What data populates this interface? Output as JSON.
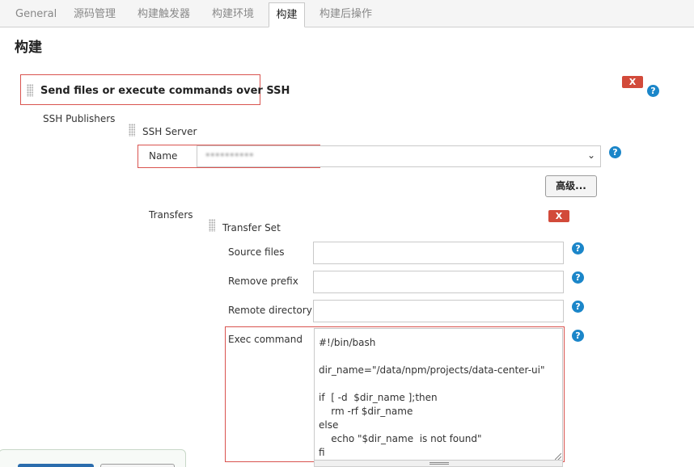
{
  "tabs": [
    {
      "label": "General"
    },
    {
      "label": "源码管理"
    },
    {
      "label": "构建触发器"
    },
    {
      "label": "构建环境"
    },
    {
      "label": "构建",
      "active": true
    },
    {
      "label": "构建后操作"
    }
  ],
  "section": {
    "title": "构建"
  },
  "build_step": {
    "title": "Send files or execute commands over SSH",
    "delete_label": "X",
    "ssh_publishers_label": "SSH Publishers",
    "ssh_server": {
      "heading": "SSH Server",
      "name_label": "Name",
      "name_value": "**********",
      "advanced_label": "高级..."
    },
    "transfers": {
      "label": "Transfers",
      "delete_label": "X",
      "transfer_set": {
        "heading": "Transfer Set",
        "source_files_label": "Source files",
        "source_files_value": "",
        "remove_prefix_label": "Remove prefix",
        "remove_prefix_value": "",
        "remote_directory_label": "Remote directory",
        "remote_directory_value": "",
        "exec_command_label": "Exec command",
        "exec_command_value": "#!/bin/bash\n\ndir_name=\"/data/npm/projects/data-center-ui\"\n\nif  [ -d  $dir_name ];then\n    rm -rf $dir_name\nelse\n    echo \"$dir_name  is not found\"\nfi"
      }
    }
  },
  "help_symbol": "?",
  "icons": {
    "drag": "drag-handle-icon",
    "help": "help-icon",
    "dropdown": "chevron-down-icon"
  },
  "colors": {
    "delete": "#d24a3a",
    "help": "#1b86c9",
    "highlight": "#d9534f",
    "primary_button": "#2b6dad"
  }
}
